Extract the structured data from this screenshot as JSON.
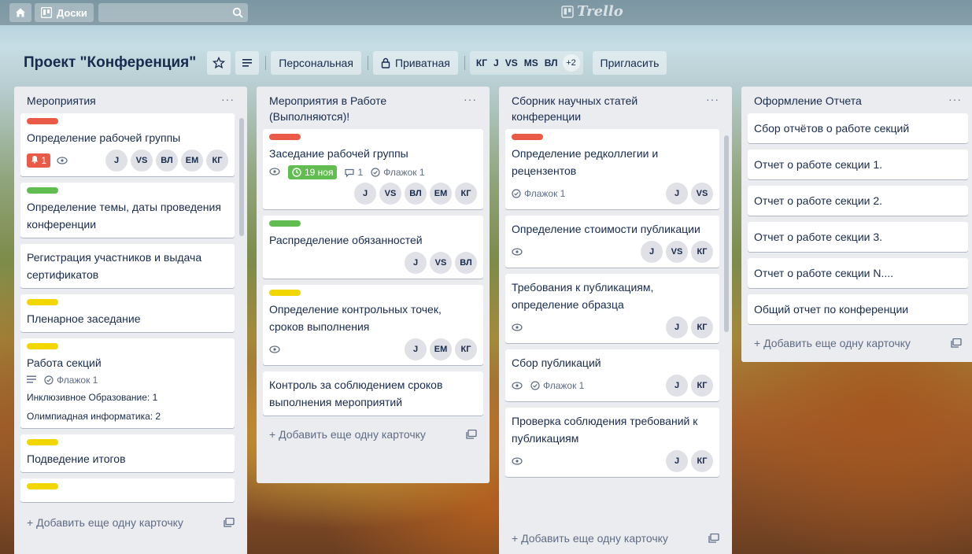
{
  "topbar": {
    "boards_label": "Доски",
    "logo_text": "Trello"
  },
  "header": {
    "title": "Проект \"Конференция\"",
    "workspace": "Персональная",
    "visibility": "Приватная",
    "members": [
      "КГ",
      "J",
      "VS",
      "MS",
      "ВЛ"
    ],
    "more_members": "+2",
    "invite": "Пригласить"
  },
  "lists": [
    {
      "title": "Мероприятия",
      "menu": "···",
      "add_card": "+ Добавить еще одну карточку",
      "cards": [
        {
          "title": "Определение рабочей группы",
          "notif": "1",
          "members": [
            "J",
            "VS",
            "ВЛ",
            "EM",
            "КГ"
          ]
        },
        {
          "title": "Определение темы, даты проведения конференции"
        },
        {
          "title": "Регистрация участников и выдача сертификатов"
        },
        {
          "title": "Пленарное заседание"
        },
        {
          "title": "Работа секций",
          "flag": "Флажок 1",
          "sub1": "Инклюзивное Образование: 1",
          "sub2": "Олимпиадная информатика: 2"
        },
        {
          "title": "Подведение итогов"
        }
      ]
    },
    {
      "title": "Мероприятия в Работе (Выполняются)!",
      "menu": "···",
      "add_card": "+ Добавить еще одну карточку",
      "cards": [
        {
          "title": "Заседание рабочей группы",
          "due": "19 ноя",
          "comments": "1",
          "flag": "Флажок 1",
          "members": [
            "J",
            "VS",
            "ВЛ",
            "EM",
            "КГ"
          ]
        },
        {
          "title": "Распределение обязанностей",
          "members": [
            "J",
            "VS",
            "ВЛ"
          ]
        },
        {
          "title": "Определение контрольных точек, сроков выполнения",
          "members": [
            "J",
            "EM",
            "КГ"
          ]
        },
        {
          "title": "Контроль за соблюдением сроков выполнения мероприятий"
        }
      ]
    },
    {
      "title": "Сборник научных статей конференции",
      "menu": "···",
      "add_card": "+ Добавить еще одну карточку",
      "cards": [
        {
          "title": "Определение редколлегии и рецензентов",
          "flag": "Флажок 1",
          "members": [
            "J",
            "VS"
          ]
        },
        {
          "title": "Определение стоимости публикации",
          "members": [
            "J",
            "VS",
            "КГ"
          ]
        },
        {
          "title": "Требования к публикациям, определение образца",
          "members": [
            "J",
            "КГ"
          ]
        },
        {
          "title": "Сбор публикаций",
          "flag": "Флажок 1",
          "members": [
            "J",
            "КГ"
          ]
        },
        {
          "title": "Проверка соблюдения требований к публикациям",
          "members": [
            "J",
            "КГ"
          ]
        }
      ]
    },
    {
      "title": "Оформление Отчета",
      "menu": "···",
      "add_card": "+ Добавить еще одну карточку",
      "cards": [
        {
          "title": "Сбор отчётов о работе секций"
        },
        {
          "title": "Отчет о работе секции 1."
        },
        {
          "title": "Отчет о работе секции 2."
        },
        {
          "title": "Отчет о работе секции 3."
        },
        {
          "title": "Отчет о работе секции N...."
        },
        {
          "title": "Общий отчет по конференции"
        }
      ]
    }
  ],
  "colors": {
    "label_red": "#eb5a46",
    "label_green": "#61bd4f",
    "label_yellow": "#f2d600",
    "list_bg": "#ebecf0"
  }
}
